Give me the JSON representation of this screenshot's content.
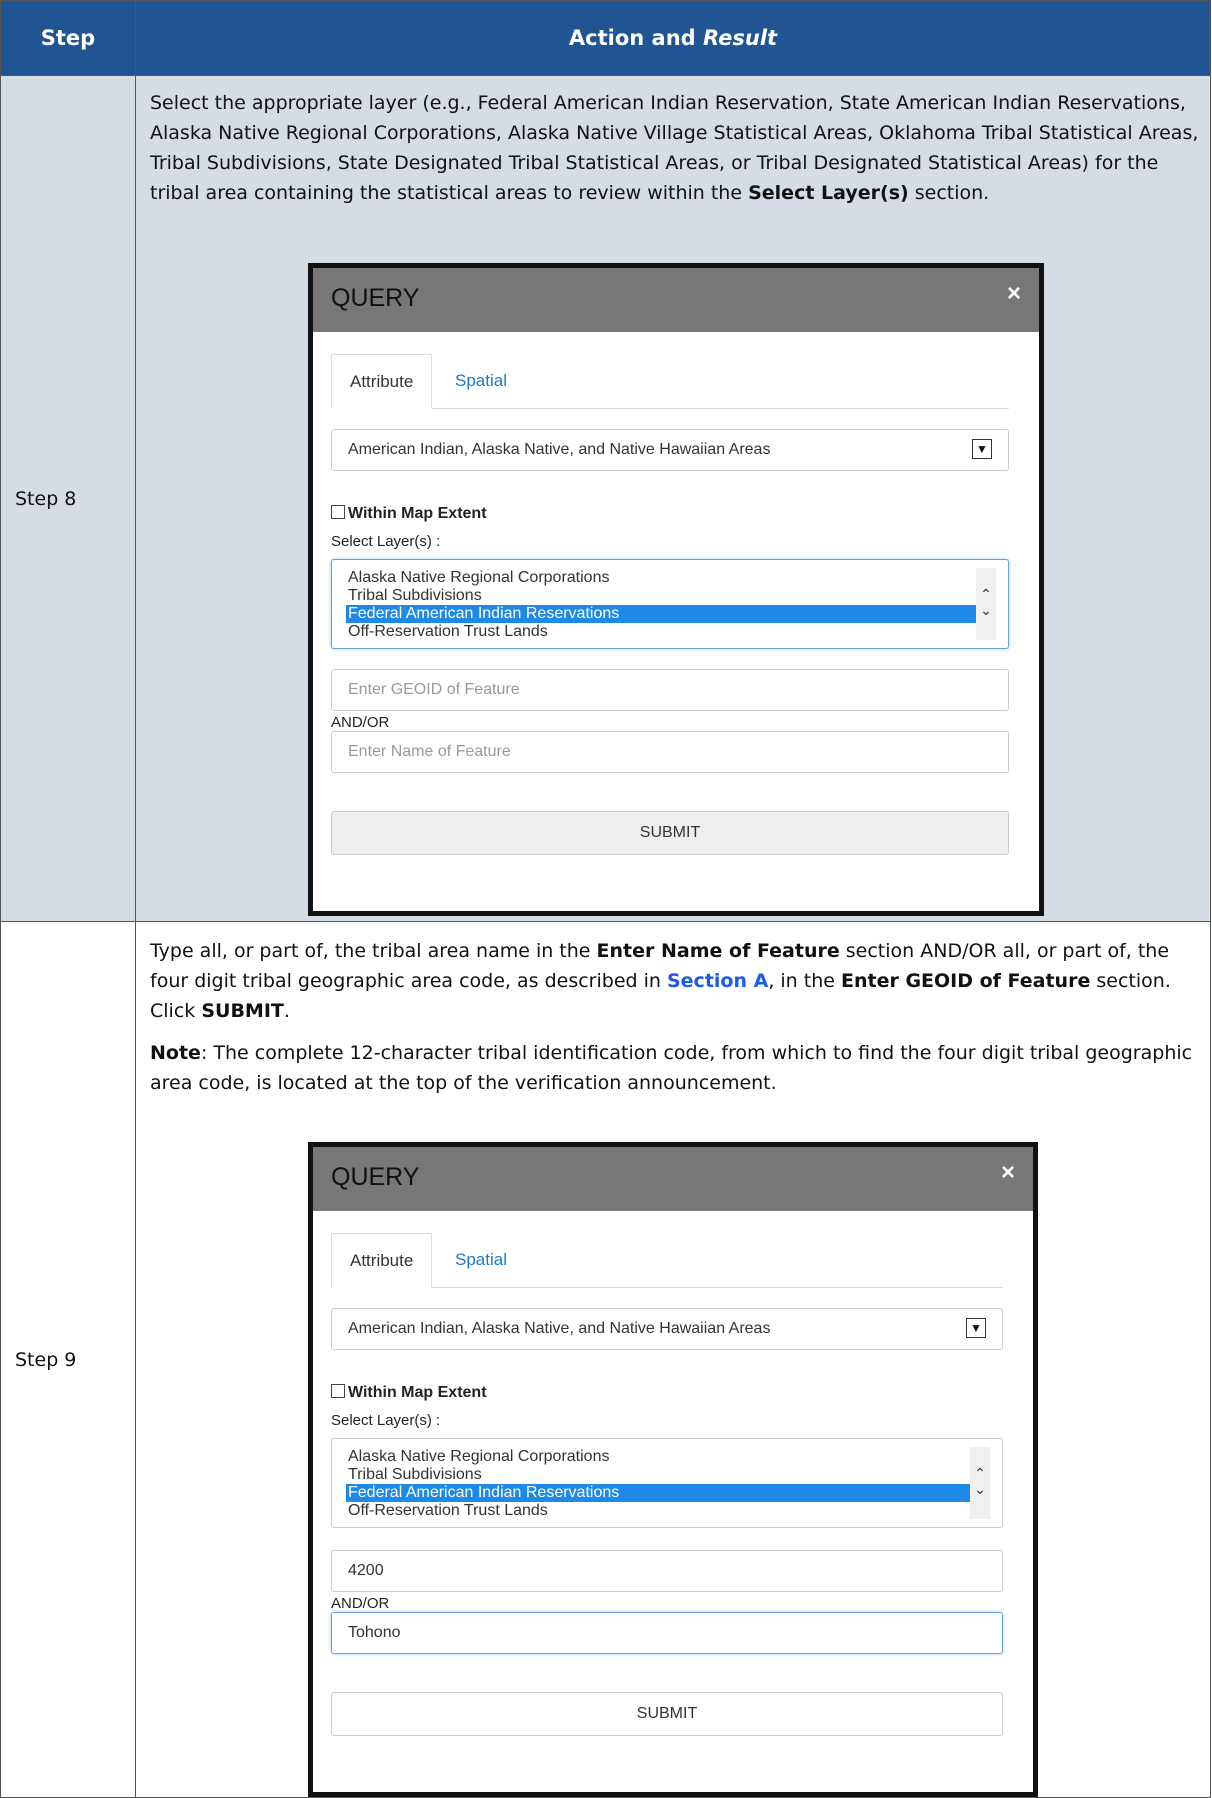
{
  "header": {
    "step": "Step",
    "action_prefix": "Action and ",
    "action_italic": "Result"
  },
  "step8": {
    "label": "Step 8",
    "text_a": "Select the appropriate layer (e.g., Federal American Indian Reservation, State American Indian Reservations, Alaska Native Regional Corporations, Alaska Native Village Statistical Areas, Oklahoma Tribal Statistical Areas, Tribal Subdivisions, State Designated Tribal Statistical Areas, or Tribal Designated Statistical Areas) for the tribal area containing the statistical areas to review within the ",
    "text_bold": "Select Layer(s)",
    "text_b": " section.",
    "dialog": {
      "title": "QUERY",
      "close": "×",
      "tab_attribute": "Attribute",
      "tab_spatial": "Spatial",
      "dropdown_value": "American Indian, Alaska Native, and Native Hawaiian Areas",
      "checkbox_label": "Within Map Extent",
      "select_layers_label": "Select Layer(s) :",
      "layers": [
        "Alaska Native Regional Corporations",
        "Tribal Subdivisions",
        "Federal American Indian Reservations",
        "Off-Reservation Trust Lands"
      ],
      "geoid_placeholder": "Enter GEOID of Feature",
      "geoid_value": "",
      "andor": "AND/OR",
      "name_placeholder": "Enter Name of Feature",
      "name_value": "",
      "submit": "SUBMIT"
    }
  },
  "step9": {
    "label": "Step 9",
    "p1_a": "Type all, or part of, the tribal area name in the ",
    "p1_b1": "Enter Name of Feature",
    "p1_c": " section AND/OR all, or part of, the four digit tribal geographic area code, as described in ",
    "p1_link": "Section A",
    "p1_d": ", in the ",
    "p1_b2": "Enter GEOID of Feature",
    "p1_e": " section. Click ",
    "p1_b3": "SUBMIT",
    "p1_f": ".",
    "note_label": "Note",
    "note_text": ": The complete 12-character tribal identification code, from which to find the four digit tribal geographic area code, is located at the top of the verification announcement.",
    "dialog": {
      "title": "QUERY",
      "close": "×",
      "tab_attribute": "Attribute",
      "tab_spatial": "Spatial",
      "dropdown_value": "American Indian, Alaska Native, and Native Hawaiian Areas",
      "checkbox_label": "Within Map Extent",
      "select_layers_label": "Select Layer(s) :",
      "layers": [
        "Alaska Native Regional Corporations",
        "Tribal Subdivisions",
        "Federal American Indian Reservations",
        "Off-Reservation Trust Lands"
      ],
      "geoid_value": "4200",
      "andor": "AND/OR",
      "name_value": "Tohono",
      "submit": "SUBMIT"
    }
  }
}
